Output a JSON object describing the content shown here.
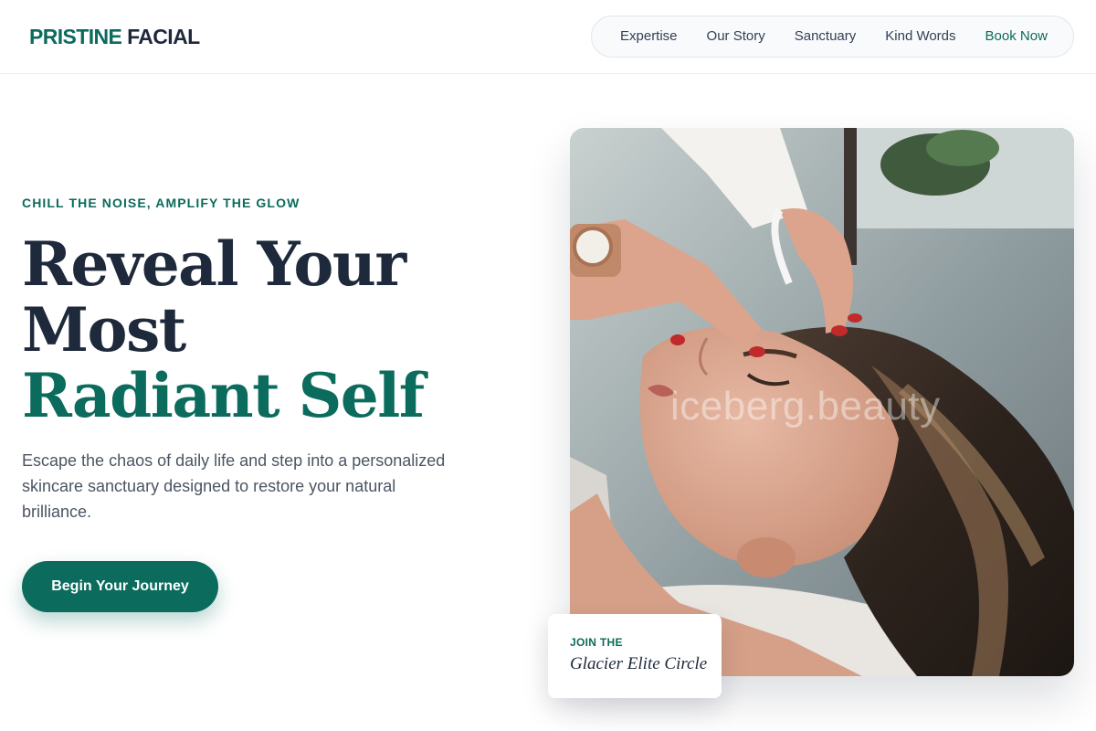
{
  "header": {
    "logo_part1": "PRISTINE",
    "logo_part2": "FACIAL",
    "nav": [
      {
        "label": "Expertise"
      },
      {
        "label": "Our Story"
      },
      {
        "label": "Sanctuary"
      },
      {
        "label": "Kind Words"
      },
      {
        "label": "Book Now"
      }
    ]
  },
  "hero": {
    "eyebrow": "CHILL THE NOISE, AMPLIFY THE GLOW",
    "headline_line1": "Reveal Your",
    "headline_line2": "Most",
    "headline_line3": "Radiant Self",
    "description": "Escape the chaos of daily life and step into a personalized skincare sanctuary designed to restore your natural brilliance.",
    "cta_label": "Begin Your Journey",
    "image_watermark": "iceberg.beauty"
  },
  "elite_card": {
    "label": "JOIN THE",
    "title": "Glacier Elite Circle"
  },
  "colors": {
    "brand": "#0b6b5c",
    "heading": "#1e293b",
    "body_text": "#4b5563"
  }
}
